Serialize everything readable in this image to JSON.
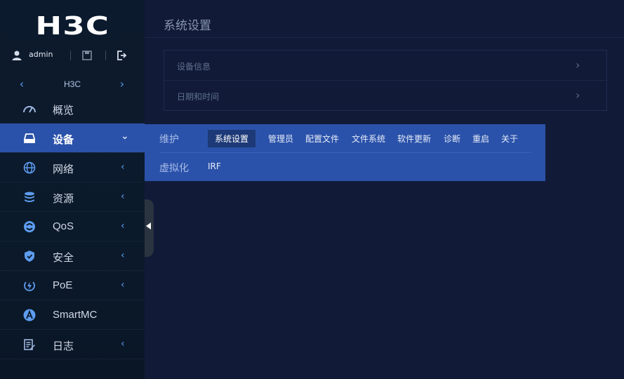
{
  "brand": {
    "logo": "H3C"
  },
  "user": {
    "name": "admin"
  },
  "device": {
    "name": "H3C"
  },
  "nav": [
    {
      "label": "概览",
      "icon": "dashboard-icon",
      "caret": ""
    },
    {
      "label": "设备",
      "icon": "device-icon",
      "caret": "⌄"
    },
    {
      "label": "网络",
      "icon": "globe-icon",
      "caret": "‹"
    },
    {
      "label": "资源",
      "icon": "database-icon",
      "caret": "‹"
    },
    {
      "label": "QoS",
      "icon": "qos-icon",
      "caret": "‹"
    },
    {
      "label": "安全",
      "icon": "shield-icon",
      "caret": "‹"
    },
    {
      "label": "PoE",
      "icon": "poe-icon",
      "caret": "‹"
    },
    {
      "label": "SmartMC",
      "icon": "smartmc-icon",
      "caret": ""
    },
    {
      "label": "日志",
      "icon": "log-icon",
      "caret": "‹"
    }
  ],
  "main": {
    "title": "系统设置",
    "rows": [
      {
        "label": "设备信息",
        "arrow": "›"
      },
      {
        "label": "日期和时间",
        "arrow": "›"
      }
    ]
  },
  "flyout": {
    "group1": "维护",
    "links1": [
      "系统设置",
      "管理员",
      "配置文件",
      "文件系统",
      "软件更新",
      "诊断",
      "重启",
      "关于"
    ],
    "group2": "虚拟化",
    "links2": [
      "IRF"
    ]
  },
  "colors": {
    "accent": "#2b52aa",
    "sidebar": "#0b1a2b",
    "background": "#111b38",
    "icon_blue": "#5d9df0"
  }
}
